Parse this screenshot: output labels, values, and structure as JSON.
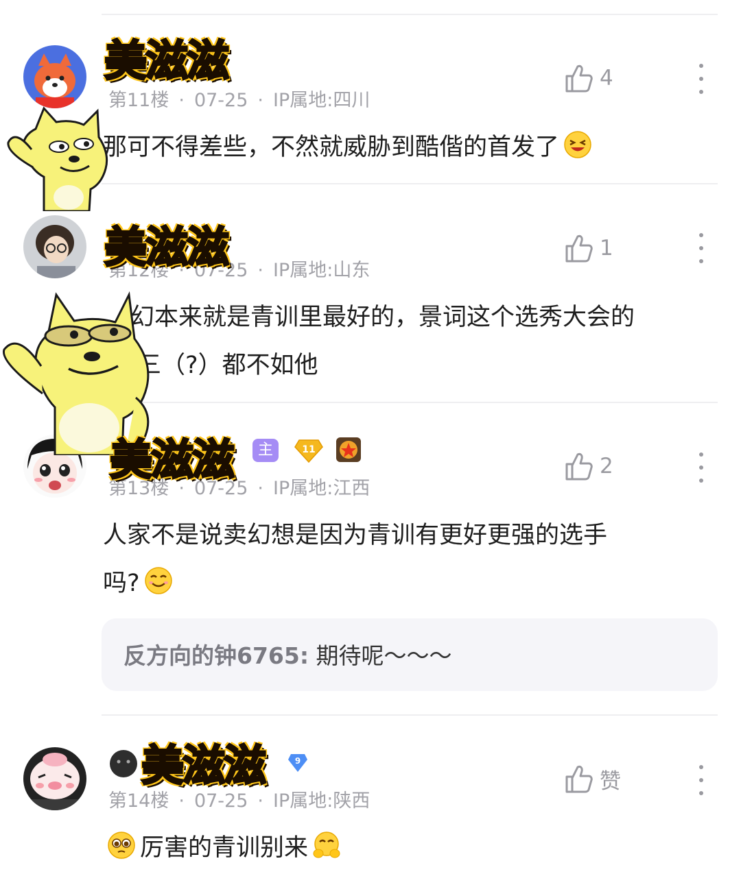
{
  "comments": [
    {
      "floor": "第11楼",
      "date": "07-25",
      "ip": "IP属地:四川",
      "likes": "4",
      "text": "那可不得差些，不然就威胁到酷偕的首发了",
      "avatar": "fox-avatar"
    },
    {
      "floor": "第12楼",
      "date": "07-25",
      "ip": "IP属地:山东",
      "likes": "1",
      "text_line1": "幻本来就是青训里最好的，景词这个选秀大会的",
      "text_line2": "三（?）都不如他",
      "avatar": "photo-avatar"
    },
    {
      "floor": "第13楼",
      "date": "07-25",
      "ip": "IP属地:江西",
      "likes": "2",
      "badge": "主",
      "level": "11",
      "text_line1": "人家不是说卖幻想是因为青训有更好更强的选手",
      "text_line2": "吗?",
      "reply": {
        "name": "反方向的钟6765:",
        "text": " 期待呢～～～"
      },
      "avatar": "cartoon-girl-avatar"
    },
    {
      "floor": "第14楼",
      "date": "07-25",
      "ip": "IP属地:陕西",
      "likes": "赞",
      "level": "9",
      "text": "厉害的青训别来",
      "avatar": "cartoon-pig-avatar"
    }
  ],
  "sticker_text": "美滋滋",
  "colors": {
    "meta": "#a2a2a8",
    "divider": "#eeeef0",
    "reply_bg": "#f5f5f9",
    "badge": "#a58cf5"
  }
}
